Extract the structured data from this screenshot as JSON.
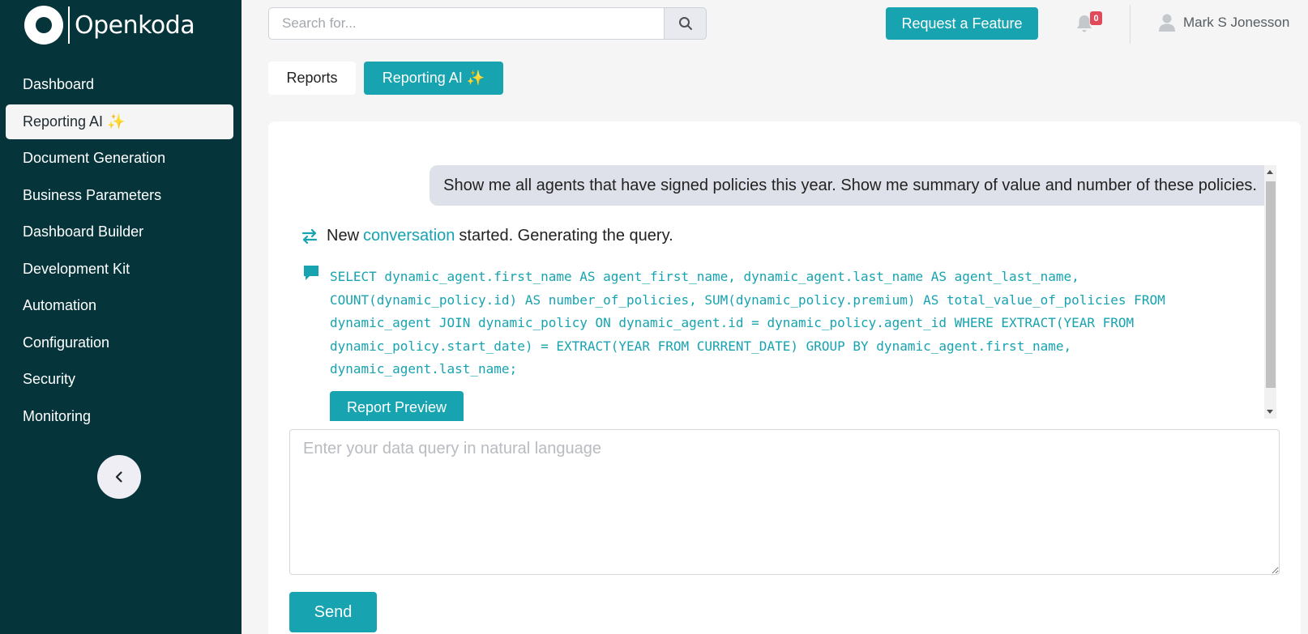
{
  "app": {
    "logo_text": "Openkoda"
  },
  "sidebar": {
    "items": [
      {
        "label": "Dashboard",
        "active": false
      },
      {
        "label": "Reporting AI ✨",
        "active": true
      },
      {
        "label": "Document Generation",
        "active": false
      },
      {
        "label": "Business Parameters",
        "active": false
      },
      {
        "label": "Dashboard Builder",
        "active": false
      },
      {
        "label": "Development Kit",
        "active": false
      },
      {
        "label": "Automation",
        "active": false
      },
      {
        "label": "Configuration",
        "active": false
      },
      {
        "label": "Security",
        "active": false
      },
      {
        "label": "Monitoring",
        "active": false
      }
    ],
    "collapse_icon": "chevron-left-icon"
  },
  "header": {
    "search_placeholder": "Search for...",
    "search_icon": "search-icon",
    "feature_button": "Request a Feature",
    "notification_count": "0",
    "user_name": "Mark S Jonesson"
  },
  "tabs": [
    {
      "label": "Reports",
      "active": false
    },
    {
      "label": "Reporting AI ✨",
      "active": true
    }
  ],
  "chat": {
    "user_message": "Show me all agents that have signed policies this year. Show me summary of value and number of these policies.",
    "status_prefix": "New",
    "status_link": "conversation",
    "status_suffix": "started. Generating the query.",
    "sql_lines": [
      "SELECT dynamic_agent.first_name AS agent_first_name, dynamic_agent.last_name AS agent_last_name,",
      "COUNT(dynamic_policy.id) AS number_of_policies, SUM(dynamic_policy.premium) AS total_value_of_policies FROM",
      "dynamic_agent JOIN dynamic_policy ON dynamic_agent.id = dynamic_policy.agent_id WHERE EXTRACT(YEAR FROM",
      "dynamic_policy.start_date) = EXTRACT(YEAR FROM CURRENT_DATE) GROUP BY dynamic_agent.first_name,",
      "dynamic_agent.last_name;"
    ],
    "preview_button": "Report Preview"
  },
  "composer": {
    "placeholder": "Enter your data query in natural language",
    "value": "",
    "send_button": "Send"
  },
  "colors": {
    "sidebar_bg": "#06343b",
    "accent": "#17a3b0",
    "badge": "#e04a5a"
  }
}
